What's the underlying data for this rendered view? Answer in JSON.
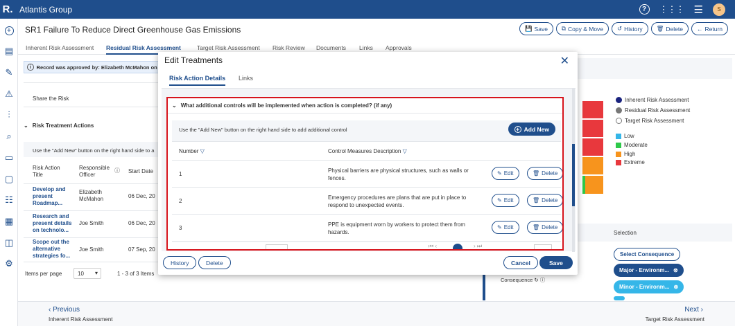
{
  "app": {
    "logo": "R.",
    "name": "Atlantis Group",
    "avatar_initial": "S"
  },
  "page": {
    "title": "SR1 Failure To Reduce Direct Greenhouse Gas Emissions"
  },
  "actions": {
    "save": "Save",
    "copy_move": "Copy & Move",
    "history": "History",
    "delete": "Delete",
    "return": "Return"
  },
  "tabs": [
    "Inherent Risk Assessment",
    "Residual Risk Assessment",
    "Target Risk Assessment",
    "Risk Review",
    "Documents",
    "Links",
    "Approvals"
  ],
  "approved_banner": "Record was approved by: Elizabeth McMahon on 2",
  "left_panel": {
    "share_risk": "Share the Risk",
    "treatment_header": "Risk Treatment Actions",
    "hint": "Use the \"Add New\" button on the right hand side to a",
    "columns": [
      "Risk Action Title",
      "Responsible Officer",
      "Start Date"
    ],
    "rows": [
      {
        "title": "Develop and present Roadmap...",
        "officer": "Elizabeth McMahon",
        "date": "06 Dec, 20"
      },
      {
        "title": "Research and present details on technolo...",
        "officer": "Joe Smith",
        "date": "06 Dec, 20"
      },
      {
        "title": "Scope out the alternative strategies fo...",
        "officer": "Joe Smith",
        "date": "07 Sep, 20"
      }
    ],
    "items_per_page_label": "Items per page",
    "items_per_page": "10",
    "range": "1 - 3 of 3 Items"
  },
  "modal": {
    "title": "Edit Treatments",
    "tabs": [
      "Risk Action Details",
      "Links"
    ],
    "question": "What additional controls will be implemented when action is completed? (if any)",
    "hint": "Use the \"Add New\" button on the right hand side to add additional control",
    "add_new": "Add New",
    "columns": [
      "Number",
      "Control Measures Description"
    ],
    "rows": [
      {
        "number": "1",
        "description": "Physical barriers are physical structures, such as walls or fences."
      },
      {
        "number": "2",
        "description": "Emergency procedures are plans that are put in place to respond to unexpected events."
      },
      {
        "number": "3",
        "description": "PPE is equipment worn by workers to protect them from hazards."
      }
    ],
    "edit_label": "Edit",
    "delete_label": "Delete",
    "footer": {
      "history": "History",
      "delete": "Delete",
      "cancel": "Cancel",
      "save": "Save"
    }
  },
  "legend": {
    "assessments": [
      "Inherent Risk Assessment",
      "Residual Risk Assessment",
      "Target Risk Assessment"
    ],
    "levels": [
      {
        "label": "Low",
        "color": "#35b6e8"
      },
      {
        "label": "Moderate",
        "color": "#2ec94a"
      },
      {
        "label": "High",
        "color": "#f7941d"
      },
      {
        "label": "Extreme",
        "color": "#e8383d"
      }
    ]
  },
  "selection": {
    "header": "Selection",
    "select_consequence": "Select Consequence",
    "consequence_label": "Consequence",
    "chips": [
      "Major - Environm...",
      "Minor - Environm..."
    ]
  },
  "footer": {
    "previous": "Previous",
    "previous_sub": "Inherent Risk Assessment",
    "next": "Next",
    "next_sub": "Target Risk Assessment"
  }
}
